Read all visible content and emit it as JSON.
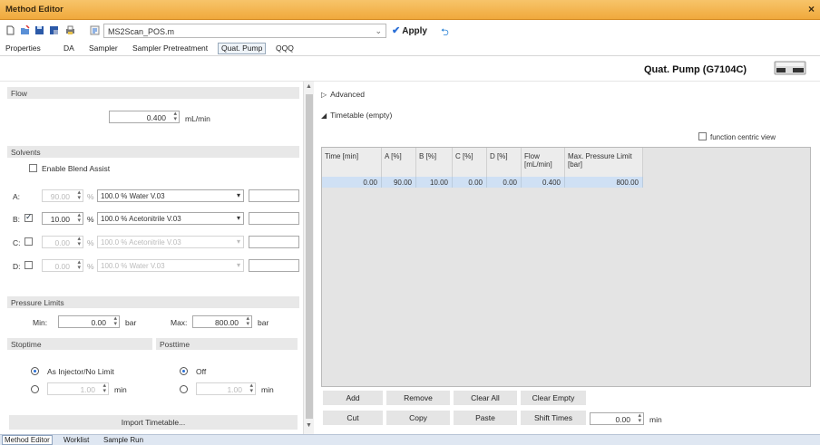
{
  "window": {
    "title": "Method Editor",
    "close": "×"
  },
  "toolbar": {
    "method_file": "MS2Scan_POS.m",
    "apply_label": "Apply"
  },
  "tabs": [
    "Properties",
    "DA",
    "Sampler",
    "Sampler Pretreatment",
    "Quat. Pump",
    "QQQ"
  ],
  "module": {
    "name": "Quat. Pump (G7104C)"
  },
  "flow": {
    "section": "Flow",
    "value": "0.400",
    "unit": "mL/min"
  },
  "solvents": {
    "section": "Solvents",
    "blend_assist": "Enable Blend Assist",
    "percent_sign": "%",
    "rows": [
      {
        "channel": "A:",
        "value": "90.00",
        "solvent": "100.0 % Water V.03",
        "enabled": true
      },
      {
        "channel": "B:",
        "value": "10.00",
        "solvent": "100.0 % Acetonitrile V.03",
        "enabled": true
      },
      {
        "channel": "C:",
        "value": "0.00",
        "solvent": "100.0 % Acetonitrile V.03",
        "enabled": false
      },
      {
        "channel": "D:",
        "value": "0.00",
        "solvent": "100.0 % Water V.03",
        "enabled": false
      }
    ]
  },
  "pressure": {
    "section": "Pressure Limits",
    "min_label": "Min:",
    "min": "0.00",
    "max_label": "Max:",
    "max": "800.00",
    "unit": "bar"
  },
  "stoptime": {
    "section": "Stoptime",
    "opt1": "As Injector/No Limit",
    "value": "1.00",
    "unit": "min"
  },
  "posttime": {
    "section": "Posttime",
    "opt1": "Off",
    "value": "1.00",
    "unit": "min"
  },
  "import_label": "Import Timetable...",
  "advanced_label": "Advanced",
  "timetable_label": "Timetable (empty)",
  "function_centric": "function centric view",
  "grid": {
    "headers": [
      "Time [min]",
      "A [%]",
      "B [%]",
      "C [%]",
      "D [%]",
      "Flow [mL/min]",
      "Max. Pressure Limit [bar]"
    ],
    "row": [
      "0.00",
      "90.00",
      "10.00",
      "0.00",
      "0.00",
      "0.400",
      "800.00"
    ]
  },
  "buttons": {
    "add": "Add",
    "remove": "Remove",
    "clear_all": "Clear All",
    "clear_empty": "Clear Empty",
    "cut": "Cut",
    "copy": "Copy",
    "paste": "Paste",
    "shift_times": "Shift Times",
    "shift_value": "0.00",
    "shift_unit": "min"
  },
  "status_tabs": [
    "Method Editor",
    "Worklist",
    "Sample Run"
  ]
}
